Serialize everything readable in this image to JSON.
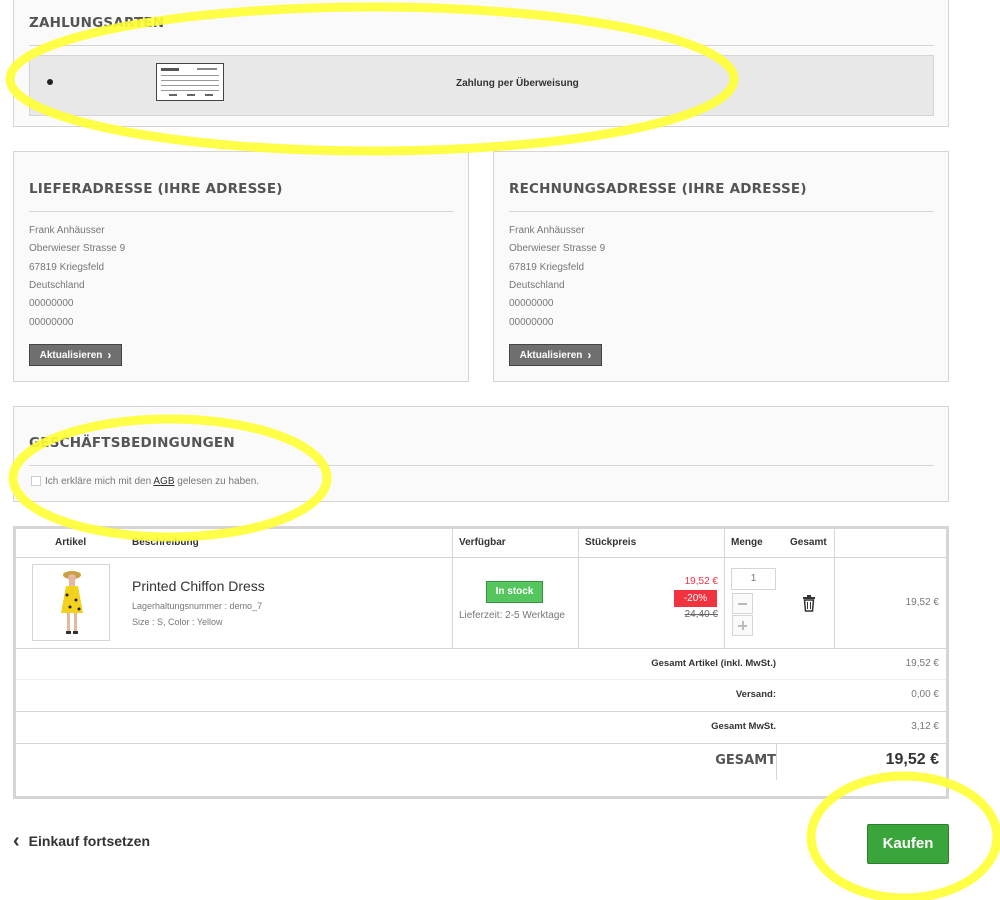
{
  "payment": {
    "heading": "ZAHLUNGSARTEN",
    "option_label": "Zahlung per Überweisung"
  },
  "delivery": {
    "heading": "LIEFERADRESSE (IHRE ADRESSE)",
    "lines": [
      "Frank Anhäusser",
      "Oberwieser Strasse 9",
      "67819 Kriegsfeld",
      "Deutschland",
      "00000000",
      "00000000"
    ],
    "update_label": "Aktualisieren"
  },
  "billing": {
    "heading": "RECHNUNGSADRESSE (IHRE ADRESSE)",
    "lines": [
      "Frank Anhäusser",
      "Oberwieser Strasse 9",
      "67819 Kriegsfeld",
      "Deutschland",
      "00000000",
      "00000000"
    ],
    "update_label": "Aktualisieren"
  },
  "terms": {
    "heading": "GESCHÄFTSBEDINGUNGEN",
    "text_before": "Ich erkläre mich mit den",
    "link": "AGB",
    "text_after": "gelesen zu haben."
  },
  "cart": {
    "headers": {
      "artikel": "Artikel",
      "beschreibung": "Beschreibung",
      "verfuegbar": "Verfügbar",
      "stueckpreis": "Stückpreis",
      "menge": "Menge",
      "gesamt": "Gesamt"
    },
    "item": {
      "name": "Printed Chiffon Dress",
      "sku": "Lagerhaltungsnummer : demo_7",
      "attributes": "Size : S, Color : Yellow",
      "stock_badge": "In stock",
      "delivery_time": "Lieferzeit: 2-5 Werktage",
      "price": "19,52 €",
      "discount": "-20%",
      "old_price": "24,40 €",
      "quantity": "1",
      "total": "19,52 €"
    },
    "summary": {
      "products_label": "Gesamt Artikel (inkl. MwSt.)",
      "products_value": "19,52 €",
      "shipping_label": "Versand:",
      "shipping_value": "0,00 €",
      "tax_label": "Gesamt MwSt.",
      "tax_value": "3,12 €",
      "total_label": "GESAMT",
      "total_value": "19,52 €"
    }
  },
  "actions": {
    "continue_label": "Einkauf fortsetzen",
    "buy_label": "Kaufen"
  },
  "colors": {
    "highlight": "#ffff33",
    "buy_button": "#3aa53a",
    "stock_badge": "#55c65e",
    "discount": "#f13340",
    "price_red": "#f13340"
  }
}
